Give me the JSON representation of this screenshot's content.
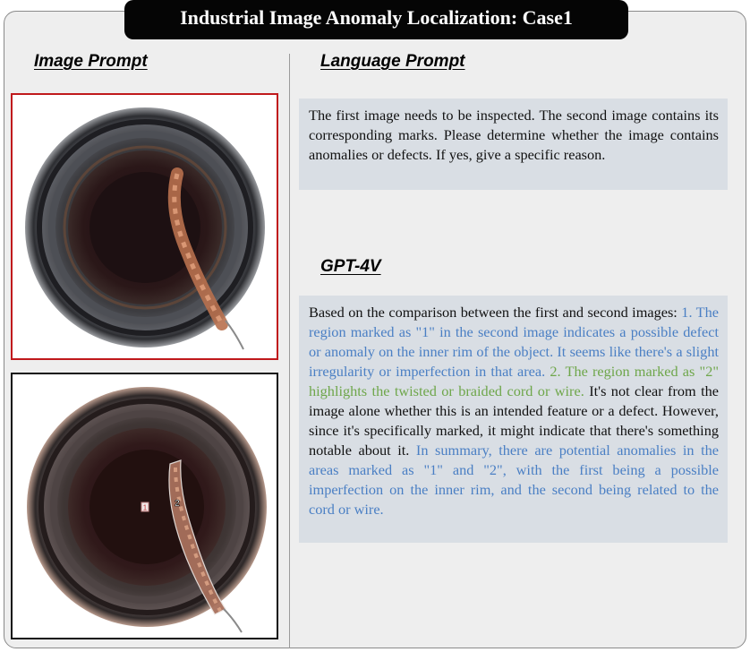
{
  "title": "Industrial Image Anomaly Localization: Case1",
  "left_heading": "Image Prompt",
  "right_heading": "Language Prompt",
  "gpt_heading": "GPT-4V",
  "prompt_text": "The first image needs to be inspected. The second image contains its corresponding marks. Please determine whether the image contains anomalies or defects. If yes, give a specific reason.",
  "response": {
    "intro": "Based on the comparison between the first and second images: ",
    "point1": "1. The region marked as \"1\" in the second image indicates a possible defect or anomaly on the inner rim of the object. It seems like there's a slight irregularity or imperfection in that area. ",
    "point2": "2. The region marked as \"2\" highlights the twisted or braided cord or wire. ",
    "middle": "It's not clear from the image alone whether this is an intended feature or a defect. However, since it's specifically marked, it might indicate that there's something notable about it. ",
    "summary": "In summary, there are potential anomalies in the areas marked as \"1\" and \"2\", with the first being a possible imperfection on the inner rim, and the second being related to the cord or wire."
  },
  "marks": {
    "mark1": "1",
    "mark2": "2"
  },
  "colors": {
    "blue_text": "#4a7fc4",
    "green_text": "#6ea64a",
    "first_image_border": "#c0191c",
    "second_image_border": "#111111",
    "text_box_bg": "#d9dee4"
  },
  "icons": [
    "bottle-top-view-image",
    "bottle-marked-image"
  ]
}
